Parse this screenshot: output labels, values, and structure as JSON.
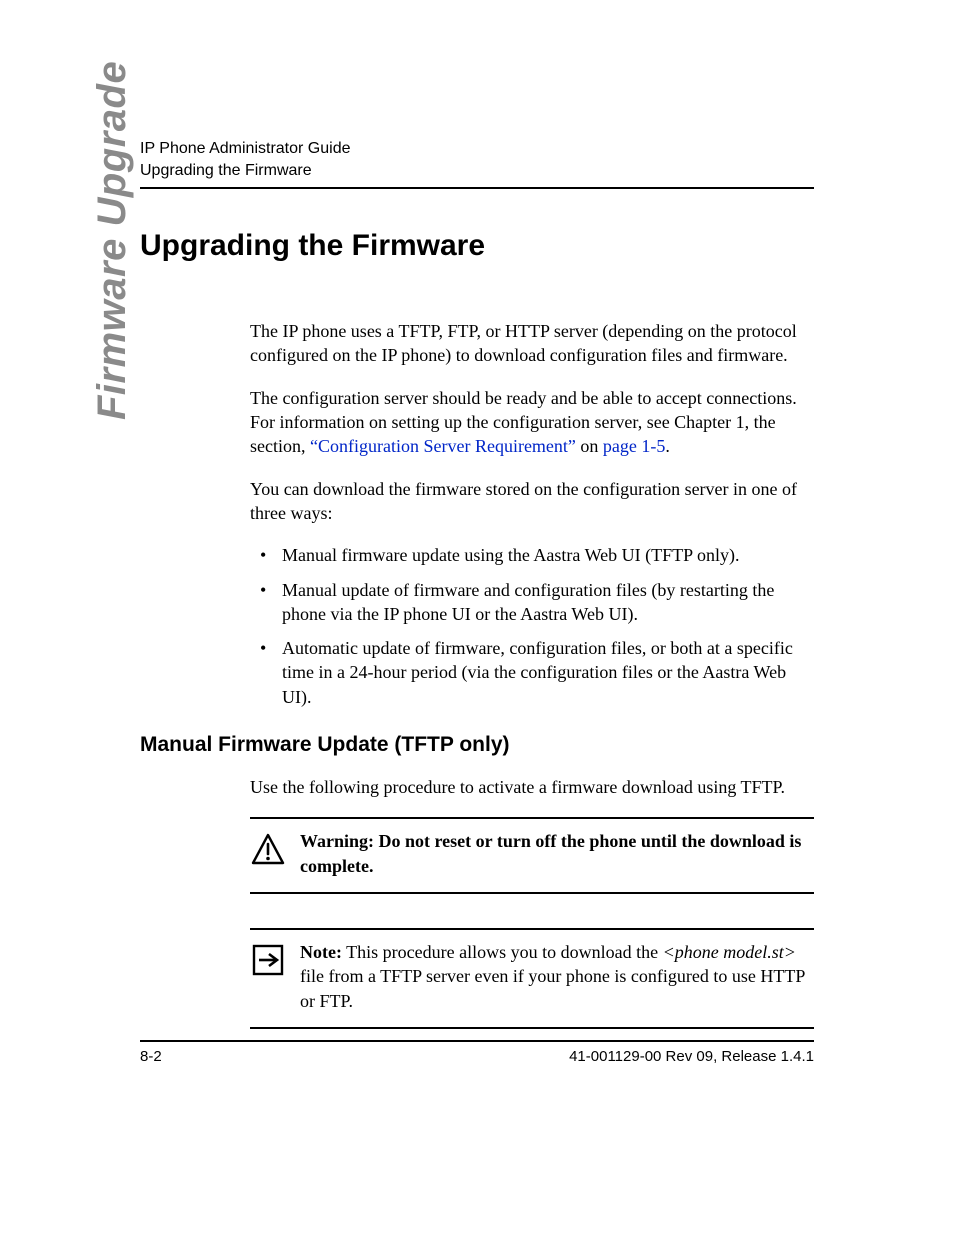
{
  "header": {
    "line1": "IP Phone Administrator Guide",
    "line2": "Upgrading the Firmware"
  },
  "side_tab": "Firmware Upgrade",
  "title": "Upgrading the Firmware",
  "para1": "The IP phone uses a TFTP, FTP, or HTTP server (depending on the protocol configured on the IP phone) to download configuration files and firmware.",
  "para2_pre": "The configuration server should be ready and be able to accept connections. For information on setting up the configuration server, see Chapter 1, the section, ",
  "para2_link1": "“Configuration Server Requirement”",
  "para2_mid": " on ",
  "para2_link2": "page 1-5",
  "para2_post": ".",
  "para3": "You can download the firmware stored on the configuration server in one of three ways:",
  "bullets": [
    "Manual firmware update using the Aastra Web UI (TFTP only).",
    "Manual update of firmware and configuration files (by restarting the phone via the IP phone UI or the Aastra Web UI).",
    "Automatic update of firmware, configuration files, or both at a specific time in a 24-hour period (via the configuration files or the Aastra Web UI)."
  ],
  "subsection": "Manual Firmware Update (TFTP only)",
  "para4": "Use the following procedure to activate a firmware download using TFTP.",
  "warning": {
    "label": "Warning:",
    "text": " Do not reset or turn off the phone until the download is complete."
  },
  "note": {
    "label": "Note:",
    "pre": " This procedure allows you to download the ",
    "italic": "<phone model.st>",
    "post": " file from a TFTP server even if your phone is configured to use HTTP or FTP."
  },
  "footer": {
    "left": "8-2",
    "right": "41-001129-00 Rev 09, Release 1.4.1"
  }
}
